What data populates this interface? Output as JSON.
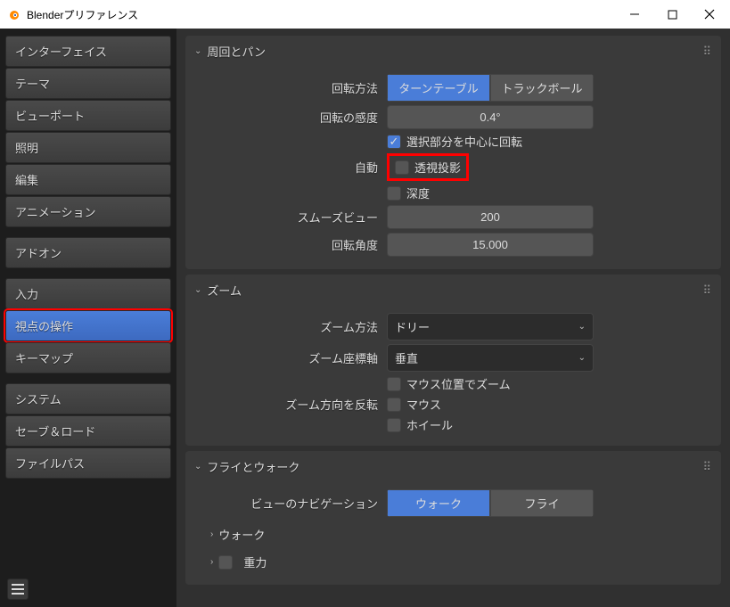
{
  "window": {
    "title": "Blenderプリファレンス"
  },
  "sidebar": {
    "items": [
      {
        "label": "インターフェイス"
      },
      {
        "label": "テーマ"
      },
      {
        "label": "ビューポート"
      },
      {
        "label": "照明"
      },
      {
        "label": "編集"
      },
      {
        "label": "アニメーション"
      },
      {
        "label": "アドオン"
      },
      {
        "label": "入力"
      },
      {
        "label": "視点の操作"
      },
      {
        "label": "キーマップ"
      },
      {
        "label": "システム"
      },
      {
        "label": "セーブ＆ロード"
      },
      {
        "label": "ファイルパス"
      }
    ]
  },
  "panels": {
    "orbit": {
      "title": "周回とパン",
      "rotate_method_label": "回転方法",
      "rotate_method_options": {
        "turntable": "ターンテーブル",
        "trackball": "トラックボール"
      },
      "rotate_sensitivity_label": "回転の感度",
      "rotate_sensitivity_value": "0.4°",
      "orbit_selection_label": "選択部分を中心に回転",
      "auto_label": "自動",
      "perspective_label": "透視投影",
      "depth_label": "深度",
      "smooth_view_label": "スムーズビュー",
      "smooth_view_value": "200",
      "rotate_angle_label": "回転角度",
      "rotate_angle_value": "15.000"
    },
    "zoom": {
      "title": "ズーム",
      "zoom_method_label": "ズーム方法",
      "zoom_method_value": "ドリー",
      "zoom_axis_label": "ズーム座標軸",
      "zoom_axis_value": "垂直",
      "zoom_mouse_pos_label": "マウス位置でズーム",
      "invert_label": "ズーム方向を反転",
      "invert_mouse_label": "マウス",
      "invert_wheel_label": "ホイール"
    },
    "fly": {
      "title": "フライとウォーク",
      "nav_label": "ビューのナビゲーション",
      "nav_options": {
        "walk": "ウォーク",
        "fly": "フライ"
      },
      "walk_sub": "ウォーク",
      "gravity_label": "重力"
    }
  }
}
